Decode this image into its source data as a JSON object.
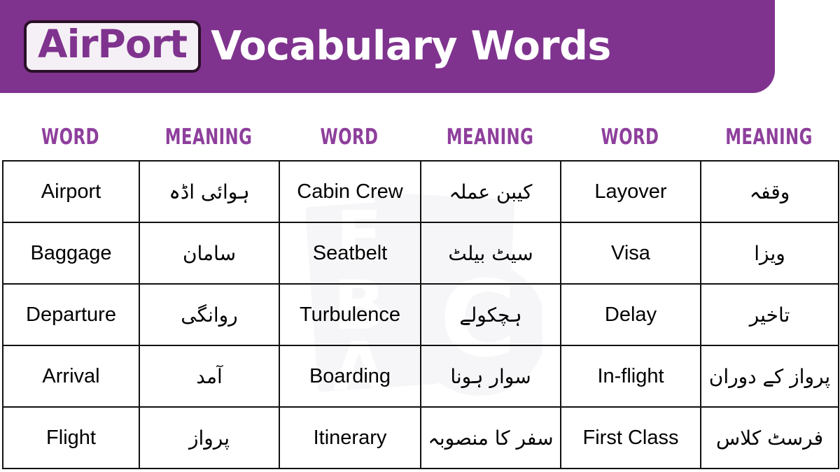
{
  "header": {
    "badge_text": "AirPort",
    "title_rest": "Vocabulary Words",
    "bar_color": "#7f338e",
    "badge_bg": "#f5f0f5",
    "badge_border": "#2a1028",
    "title_color": "#ffffff"
  },
  "table": {
    "header_color": "#8e3f9c",
    "border_color": "#111111",
    "headers": [
      {
        "label": "WORD"
      },
      {
        "label": "MEANING"
      },
      {
        "label": "WORD"
      },
      {
        "label": "MEANING"
      },
      {
        "label": "WORD"
      },
      {
        "label": "MEANING"
      }
    ],
    "rows": [
      {
        "word1": "Airport",
        "meaning1": "ہوائی اڈہ",
        "word2": "Cabin Crew",
        "meaning2": "کیبن عملہ",
        "word3": "Layover",
        "meaning3": "وقفہ"
      },
      {
        "word1": "Baggage",
        "meaning1": "سامان",
        "word2": "Seatbelt",
        "meaning2": "سیٹ بیلٹ",
        "word3": "Visa",
        "meaning3": "ویزا"
      },
      {
        "word1": "Departure",
        "meaning1": "روانگی",
        "word2": "Turbulence",
        "meaning2": "ہچکولے",
        "word3": "Delay",
        "meaning3": "تاخیر"
      },
      {
        "word1": "Arrival",
        "meaning1": "آمد",
        "word2": "Boarding",
        "meaning2": "سوار ہونا",
        "word3": "In-flight",
        "meaning3": "پرواز کے دوران"
      },
      {
        "word1": "Flight",
        "meaning1": "پرواز",
        "word2": "Itinerary",
        "meaning2": "سفر کا منصوبہ",
        "word3": "First Class",
        "meaning3": "فرسٹ کلاس"
      }
    ]
  },
  "watermark": {
    "letters": [
      "E",
      "B",
      "A",
      "C"
    ],
    "color": "#ededf2"
  }
}
